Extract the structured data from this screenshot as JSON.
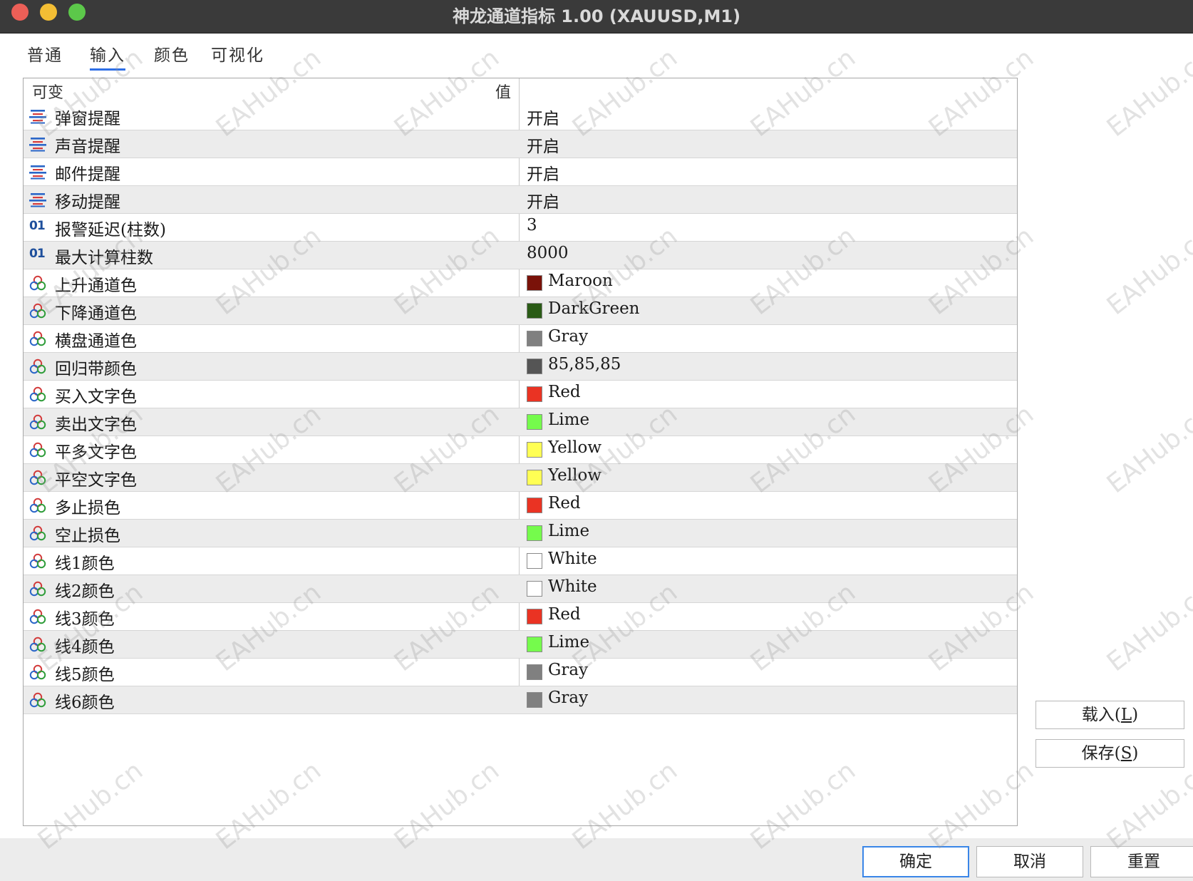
{
  "window": {
    "title": "神龙通道指标 1.00 (XAUUSD,M1)"
  },
  "tabs": [
    {
      "label": "普通",
      "active": false
    },
    {
      "label": "输入",
      "active": true
    },
    {
      "label": "颜色",
      "active": false
    },
    {
      "label": "可视化",
      "active": false
    }
  ],
  "grid": {
    "col_name": "可变",
    "col_value": "值",
    "rows": [
      {
        "type": "bool",
        "name": "弹窗提醒",
        "value": "开启"
      },
      {
        "type": "bool",
        "name": "声音提醒",
        "value": "开启"
      },
      {
        "type": "bool",
        "name": "邮件提醒",
        "value": "开启"
      },
      {
        "type": "bool",
        "name": "移动提醒",
        "value": "开启"
      },
      {
        "type": "int",
        "name": "报警延迟(柱数)",
        "value": "3"
      },
      {
        "type": "int",
        "name": "最大计算柱数",
        "value": "8000"
      },
      {
        "type": "color",
        "name": "上升通道色",
        "value": "Maroon",
        "swatch": "#7a1209"
      },
      {
        "type": "color",
        "name": "下降通道色",
        "value": "DarkGreen",
        "swatch": "#2a5b16"
      },
      {
        "type": "color",
        "name": "横盘通道色",
        "value": "Gray",
        "swatch": "#808080"
      },
      {
        "type": "color",
        "name": "回归带颜色",
        "value": "85,85,85",
        "swatch": "#555555"
      },
      {
        "type": "color",
        "name": "买入文字色",
        "value": "Red",
        "swatch": "#ea3323"
      },
      {
        "type": "color",
        "name": "卖出文字色",
        "value": "Lime",
        "swatch": "#75fb4c"
      },
      {
        "type": "color",
        "name": "平多文字色",
        "value": "Yellow",
        "swatch": "#ffff54"
      },
      {
        "type": "color",
        "name": "平空文字色",
        "value": "Yellow",
        "swatch": "#ffff54"
      },
      {
        "type": "color",
        "name": "多止损色",
        "value": "Red",
        "swatch": "#ea3323"
      },
      {
        "type": "color",
        "name": "空止损色",
        "value": "Lime",
        "swatch": "#75fb4c"
      },
      {
        "type": "color",
        "name": "线1颜色",
        "value": "White",
        "swatch": "#ffffff"
      },
      {
        "type": "color",
        "name": "线2颜色",
        "value": "White",
        "swatch": "#ffffff"
      },
      {
        "type": "color",
        "name": "线3颜色",
        "value": "Red",
        "swatch": "#ea3323"
      },
      {
        "type": "color",
        "name": "线4颜色",
        "value": "Lime",
        "swatch": "#75fb4c"
      },
      {
        "type": "color",
        "name": "线5颜色",
        "value": "Gray",
        "swatch": "#808080"
      },
      {
        "type": "color",
        "name": "线6颜色",
        "value": "Gray",
        "swatch": "#808080"
      }
    ]
  },
  "side_buttons": {
    "load": {
      "text": "载入(",
      "key": "L",
      "end": ")"
    },
    "save": {
      "text": "保存(",
      "key": "S",
      "end": ")"
    }
  },
  "bottom_buttons": {
    "ok": "确定",
    "cancel": "取消",
    "reset": "重置"
  },
  "watermark": "EAHub.cn",
  "icons": {
    "bool": "enum-list-icon",
    "int": "integer-01-icon",
    "color": "color-circles-icon"
  },
  "colors": {
    "accent": "#2e6fe6",
    "row_alt": "#ececec",
    "title_bar": "#3a3a3a"
  }
}
